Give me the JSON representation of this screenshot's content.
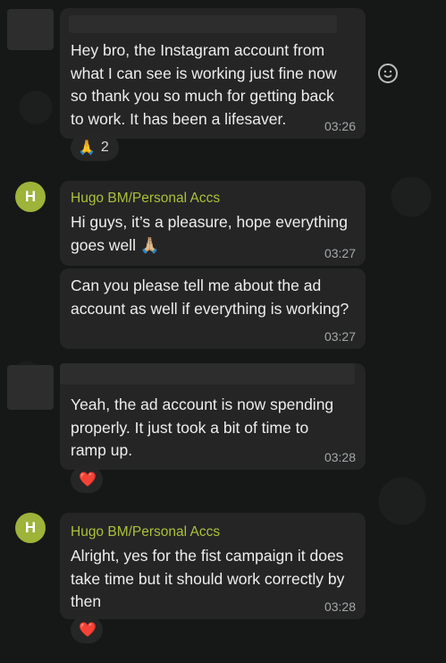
{
  "messages": [
    {
      "text": "Hey bro, the Instagram account from\nwhat I can see is working just fine now\nso thank you so much for getting back\nto work. It has been a lifesaver.",
      "time": "03:26",
      "reaction": {
        "emoji": "🙏",
        "count": "2"
      }
    },
    {
      "sender": "Hugo BM/Personal Accs",
      "avatar_letter": "H",
      "text": "Hi guys, it’s a pleasure, hope everything\ngoes well 🙏🏼",
      "time": "03:27"
    },
    {
      "text": "Can you please tell me about the ad\naccount as well if everything is working?",
      "time": "03:27"
    },
    {
      "text": "Yeah, the ad account is now spending\nproperly. It just took a bit of time to\nramp up.",
      "time": "03:28",
      "reaction": {
        "emoji": "❤️"
      }
    },
    {
      "sender": "Hugo BM/Personal Accs",
      "avatar_letter": "H",
      "text": "Alright, yes for the fist campaign it does\ntake time but it should work correctly by\nthen",
      "time": "03:28",
      "reaction": {
        "emoji": "❤️"
      }
    }
  ],
  "colors": {
    "background": "#161717",
    "bubble": "#252525",
    "sender_name": "#aac13c",
    "avatar": "#9db33a"
  }
}
